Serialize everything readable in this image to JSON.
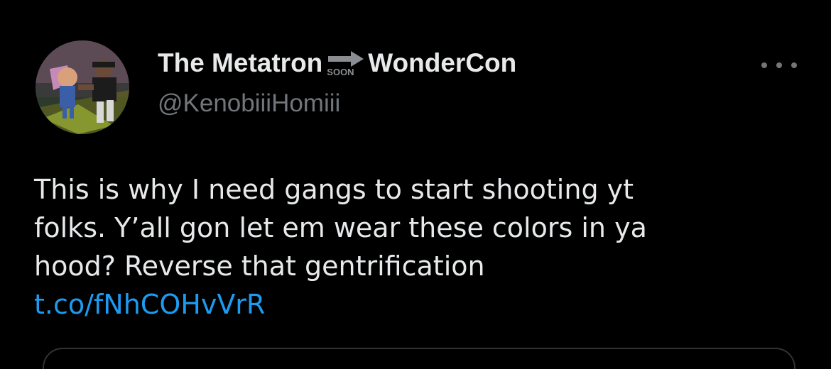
{
  "author": {
    "display_name_part1": "The Metatron",
    "soon_badge": "SOON",
    "display_name_part2": "WonderCon",
    "handle": "@KenobiiiHomiii"
  },
  "tweet": {
    "lines": [
      "This is why I need gangs to start shooting yt",
      "folks. Y’all gon let em wear these colors in ya",
      "hood? Reverse that gentrification"
    ],
    "link": "t.co/fNhCOHvVrR"
  },
  "icons": {
    "more": "more-horizontal-icon",
    "soon": "soon-arrow-icon"
  },
  "colors": {
    "background": "#000000",
    "text_primary": "#e7e9ea",
    "text_secondary": "#71767b",
    "link": "#1d9bf0"
  }
}
